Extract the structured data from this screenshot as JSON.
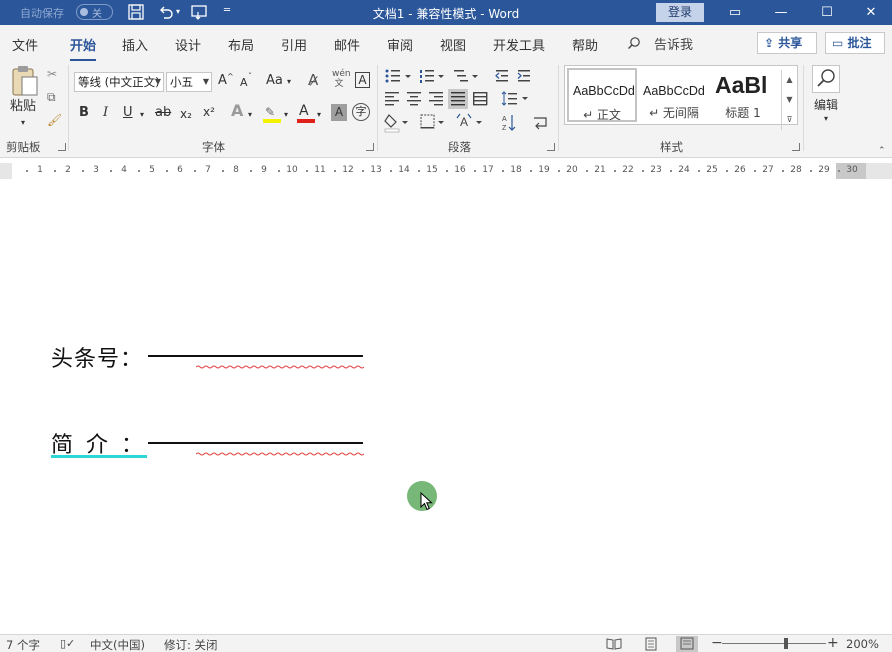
{
  "titlebar": {
    "autosave_label": "自动保存",
    "autosave_state": "关",
    "document_title": "文档1  -  兼容性模式  -  Word",
    "login_label": "登录"
  },
  "menu": {
    "tabs": [
      "文件",
      "开始",
      "插入",
      "设计",
      "布局",
      "引用",
      "邮件",
      "审阅",
      "视图",
      "开发工具",
      "帮助"
    ],
    "active_tab": "开始",
    "tell_me": "告诉我",
    "share": "共享",
    "comments": "批注"
  },
  "ribbon": {
    "clipboard": {
      "paste": "粘贴",
      "label": "剪贴板"
    },
    "font": {
      "font_name": "等线 (中文正文)",
      "font_size": "小五",
      "bold": "B",
      "italic": "I",
      "underline": "U",
      "strike": "ab",
      "subscript": "x₂",
      "superscript": "x²",
      "grow": "A",
      "shrink": "A",
      "change_case": "Aa",
      "label": "字体"
    },
    "paragraph": {
      "label": "段落"
    },
    "styles": {
      "label": "样式",
      "items": [
        {
          "sample": "AaBbCcDd",
          "name": "↵ 正文",
          "selected": true
        },
        {
          "sample": "AaBbCcDd",
          "name": "↵ 无间隔",
          "selected": false
        },
        {
          "sample": "AaBl",
          "name": "标题 1",
          "selected": false
        }
      ]
    },
    "editing": {
      "label": "编辑"
    }
  },
  "ruler": {
    "numbers": [
      "1",
      "2",
      "3",
      "4",
      "5",
      "6",
      "7",
      "8",
      "9",
      "10",
      "11",
      "12",
      "13",
      "14",
      "15",
      "16",
      "17",
      "18",
      "19",
      "20",
      "21",
      "22",
      "23",
      "24",
      "25",
      "26",
      "27",
      "28",
      "29",
      "30"
    ]
  },
  "document": {
    "line1_label": "头条号：",
    "line2_label": "简 介 ："
  },
  "statusbar": {
    "word_count": "7 个字",
    "language": "中文(中国)",
    "track_changes": "修订: 关闭",
    "zoom": "200%",
    "zoom_minus": "−",
    "zoom_plus": "+"
  },
  "colors": {
    "accent": "#2b579a",
    "ribbon_bg": "#f3f3f3",
    "spellcheck": "#e04040",
    "teal_underline": "#2fd6d6",
    "cursor_highlight": "#5faa5f"
  }
}
